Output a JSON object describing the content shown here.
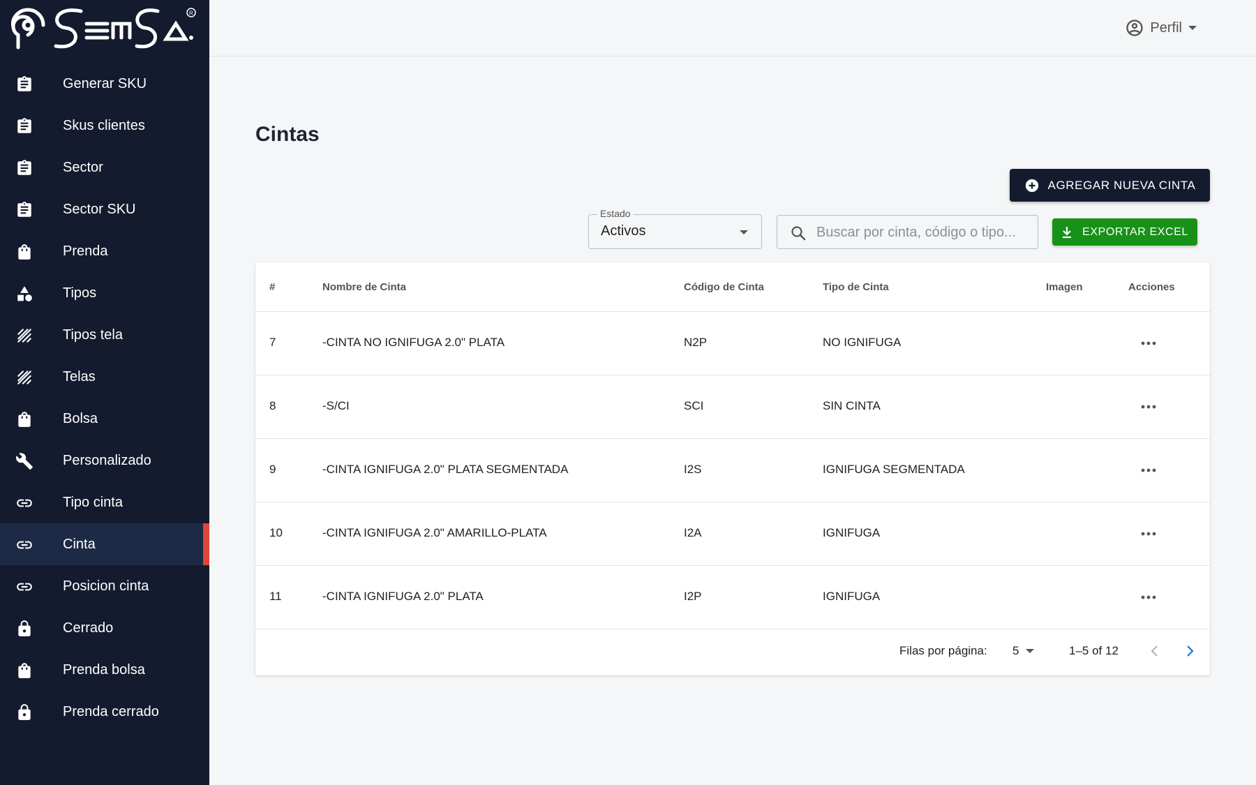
{
  "brand": {
    "logo_text": "SEMSA",
    "registered_mark": "R"
  },
  "sidebar": {
    "items": [
      {
        "label": "Generar SKU",
        "icon": "clipboard-icon"
      },
      {
        "label": "Skus clientes",
        "icon": "clipboard-icon"
      },
      {
        "label": "Sector",
        "icon": "clipboard-icon"
      },
      {
        "label": "Sector SKU",
        "icon": "clipboard-icon"
      },
      {
        "label": "Prenda",
        "icon": "shopping-bag-icon"
      },
      {
        "label": "Tipos",
        "icon": "shapes-icon"
      },
      {
        "label": "Tipos tela",
        "icon": "texture-icon"
      },
      {
        "label": "Telas",
        "icon": "texture-icon"
      },
      {
        "label": "Bolsa",
        "icon": "shopping-bag-icon"
      },
      {
        "label": "Personalizado",
        "icon": "wrench-icon"
      },
      {
        "label": "Tipo cinta",
        "icon": "link-icon"
      },
      {
        "label": "Cinta",
        "icon": "link-icon"
      },
      {
        "label": "Posicion cinta",
        "icon": "link-icon"
      },
      {
        "label": "Cerrado",
        "icon": "lock-icon"
      },
      {
        "label": "Prenda bolsa",
        "icon": "shopping-bag-icon"
      },
      {
        "label": "Prenda cerrado",
        "icon": "lock-icon"
      }
    ],
    "active": "Cinta",
    "active_color": "#e0453a"
  },
  "header": {
    "profile_label": "Perfil"
  },
  "main": {
    "title": "Cintas",
    "add_button": "AGREGAR NUEVA CINTA",
    "filter": {
      "label": "Estado",
      "value": "Activos"
    },
    "search": {
      "placeholder": "Buscar por cinta, código o tipo..."
    },
    "export_button": "EXPORTAR EXCEL",
    "export_color": "#179117"
  },
  "table": {
    "headers": {
      "num": "#",
      "name": "Nombre de Cinta",
      "code": "Código de Cinta",
      "type": "Tipo de Cinta",
      "image": "Imagen",
      "actions": "Acciones"
    },
    "rows": [
      {
        "num": "7",
        "name": "-CINTA NO IGNIFUGA 2.0\" PLATA",
        "code": "N2P",
        "type": "NO IGNIFUGA"
      },
      {
        "num": "8",
        "name": "-S/CI",
        "code": "SCI",
        "type": "SIN CINTA"
      },
      {
        "num": "9",
        "name": "-CINTA IGNIFUGA 2.0\" PLATA SEGMENTADA",
        "code": "I2S",
        "type": "IGNIFUGA SEGMENTADA"
      },
      {
        "num": "10",
        "name": "-CINTA IGNIFUGA 2.0\" AMARILLO-PLATA",
        "code": "I2A",
        "type": "IGNIFUGA"
      },
      {
        "num": "11",
        "name": "-CINTA IGNIFUGA 2.0\" PLATA",
        "code": "I2P",
        "type": "IGNIFUGA"
      }
    ],
    "pagination": {
      "rows_label": "Filas por página:",
      "rows_per_page": "5",
      "range": "1–5 of 12"
    }
  }
}
